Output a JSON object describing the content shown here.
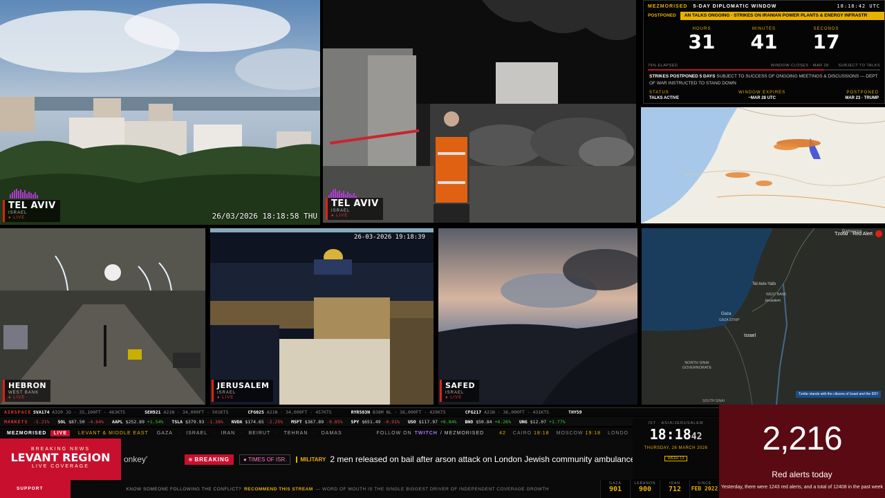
{
  "cams": {
    "tl": {
      "city": "TEL AVIV",
      "country": "ISRAEL",
      "live": "● LIVE",
      "timestamp": "26/03/2026 18:18:58 THU"
    },
    "tm": {
      "city": "TEL AVIV",
      "country": "ISRAEL",
      "live": "● LIVE"
    },
    "hebron": {
      "city": "HEBRON",
      "country": "WEST BANK",
      "live": "● LIVE"
    },
    "jerusalem": {
      "city": "JERUSALEM",
      "country": "ISRAEL",
      "live": "● LIVE",
      "timestamp": "26-03-2026 19:18:39"
    },
    "safed": {
      "city": "SAFED",
      "country": "ISRAEL",
      "live": "● LIVE"
    }
  },
  "countdown": {
    "brand": "MEZMORISED",
    "title": "5-DAY DIPLOMATIC WINDOW",
    "time": "18:18:42 UTC",
    "status_tag": "POSTPONED",
    "status_scroll": "AN TALKS ONGOING · STRIKES ON IRANIAN POWER PLANTS & ENERGY INFRASTR",
    "hours_label": "HOURS",
    "hours": "31",
    "minutes_label": "MINUTES",
    "minutes": "41",
    "seconds_label": "SECONDS",
    "seconds": "17",
    "elapsed": "76% ELAPSED",
    "closes": "WINDOW CLOSES · MAR 28",
    "subject": "SUBJECT TO TALKS",
    "progress": 0.76,
    "msg_bold": "STRIKES POSTPONED 5 DAYS",
    "msg": "SUBJECT TO SUCCESS OF ONGOING MEETINGS & DISCUSSIONS — DEPT OF WAR INSTRUCTED TO STAND DOWN",
    "status_k": "STATUS",
    "status_v": "TALKS ACTIVE",
    "expires_k": "WINDOW EXPIRES",
    "expires_v": "~MAR 28 UTC",
    "postponed_k": "POSTPONED",
    "postponed_v": "MAR 23 · TRUMP"
  },
  "map2": {
    "alert_title": "Tzofar · Red Alert",
    "footer": "Tzofar stands with the citizens of Israel and the IDF!",
    "labels": {
      "damascus": "Damascus",
      "tel_aviv": "Tel Aviv-Yafo",
      "west_bank": "WEST BANK",
      "gaza": "Gaza",
      "gaza_strip": "GAZA STRIP",
      "israel": "Israel",
      "sinai": "NORTH SINAI GOVERNORATE",
      "jerusalem": "Jerusalem",
      "south_sinai": "SOUTH SINAI"
    }
  },
  "airspace": {
    "tag": "AIRSPACE",
    "items": [
      {
        "code": "SVA174",
        "info": "A320 JO · 35,100FT · 463KTS"
      },
      {
        "code": "SEH921",
        "info": "A21N · 34,000FT · 501KTS"
      },
      {
        "code": "CFG025",
        "info": "A21N · 34,000FT · 457KTS"
      },
      {
        "code": "RYR583N",
        "info": "B38M NL · 36,000FT · 429KTS"
      },
      {
        "code": "CFG217",
        "info": "A21N · 36,000FT · 431KTS"
      },
      {
        "code": "THY59",
        "info": ""
      }
    ]
  },
  "markets": {
    "tag": "MARKETS",
    "items": [
      {
        "sym": "",
        "price": "",
        "chg": "-5.21%",
        "dir": "dn"
      },
      {
        "sym": "SOL",
        "price": "$87.50",
        "chg": "-4.64%",
        "dir": "dn"
      },
      {
        "sym": "AAPL",
        "price": "$252.89",
        "chg": "+1.54%",
        "dir": "up"
      },
      {
        "sym": "TSLA",
        "price": "$379.93",
        "chg": "-1.38%",
        "dir": "dn"
      },
      {
        "sym": "NVDA",
        "price": "$174.65",
        "chg": "-2.25%",
        "dir": "dn"
      },
      {
        "sym": "MSFT",
        "price": "$367.89",
        "chg": "-0.85%",
        "dir": "dn"
      },
      {
        "sym": "SPY",
        "price": "$651.49",
        "chg": "-0.91%",
        "dir": "dn"
      },
      {
        "sym": "USO",
        "price": "$117.97",
        "chg": "+6.84%",
        "dir": "up"
      },
      {
        "sym": "BNO",
        "price": "$50.84",
        "chg": "+4.26%",
        "dir": "up"
      },
      {
        "sym": "UNG",
        "price": "$12.07",
        "chg": "+1.77%",
        "dir": "up"
      }
    ]
  },
  "bottom": {
    "brand": "MEZMORISED",
    "live": "LIVE",
    "region_small": "LEVANT & MIDDLE EAST",
    "regions": [
      "GAZA",
      "ISRAEL",
      "IRAN",
      "BEIRUT",
      "TEHRAN",
      "DAMAS"
    ],
    "follow_pre": "FOLLOW ON",
    "follow_platform": "TWITCH",
    "follow_handle": "/ MEZMORISED",
    "breaking_news": "BREAKING NEWS",
    "region_big": "LEVANT REGION",
    "live_coverage": "LIVE COVERAGE",
    "scroll_prev": "onkey'",
    "breaking": "BREAKING",
    "source": "TIMES OF ISR.",
    "category": "MILITARY",
    "headline": "2 men released on bail after arson attack on London Jewish community ambulances",
    "support": "SUPPORT",
    "support_q": "KNOW SOMEONE FOLLOWING THE CONFLICT?",
    "support_b": "RECOMMEND THIS STREAM",
    "support_t": "— WORD OF MOUTH IS THE SINGLE BIGGEST DRIVER OF INDEPENDENT COVERAGE GROWTH",
    "clocks": [
      {
        "city": "",
        "time": "42"
      },
      {
        "city": "CAIRO",
        "time": "18:18"
      },
      {
        "city": "MOSCOW",
        "time": "19:18"
      },
      {
        "city": "LONDO",
        "time": ""
      }
    ]
  },
  "clock": {
    "zone": "IST · ASIA/JERUSALEM",
    "hm": "18:18",
    "s": "42",
    "date": "THURSDAY, 26 MARCH 2026",
    "week": "WEEK 13"
  },
  "stats": [
    {
      "label": "GAZA",
      "value": "901"
    },
    {
      "label": "LEBANON",
      "value": "900"
    },
    {
      "label": "IRAN",
      "value": "712"
    },
    {
      "label": "SINCE",
      "value": "FEB 2022"
    }
  ],
  "red_alerts": {
    "count": "2,216",
    "label": "Red alerts today",
    "note": "Yesterday, there were 1243 red alerts, and a total of 12408 in the past week"
  }
}
